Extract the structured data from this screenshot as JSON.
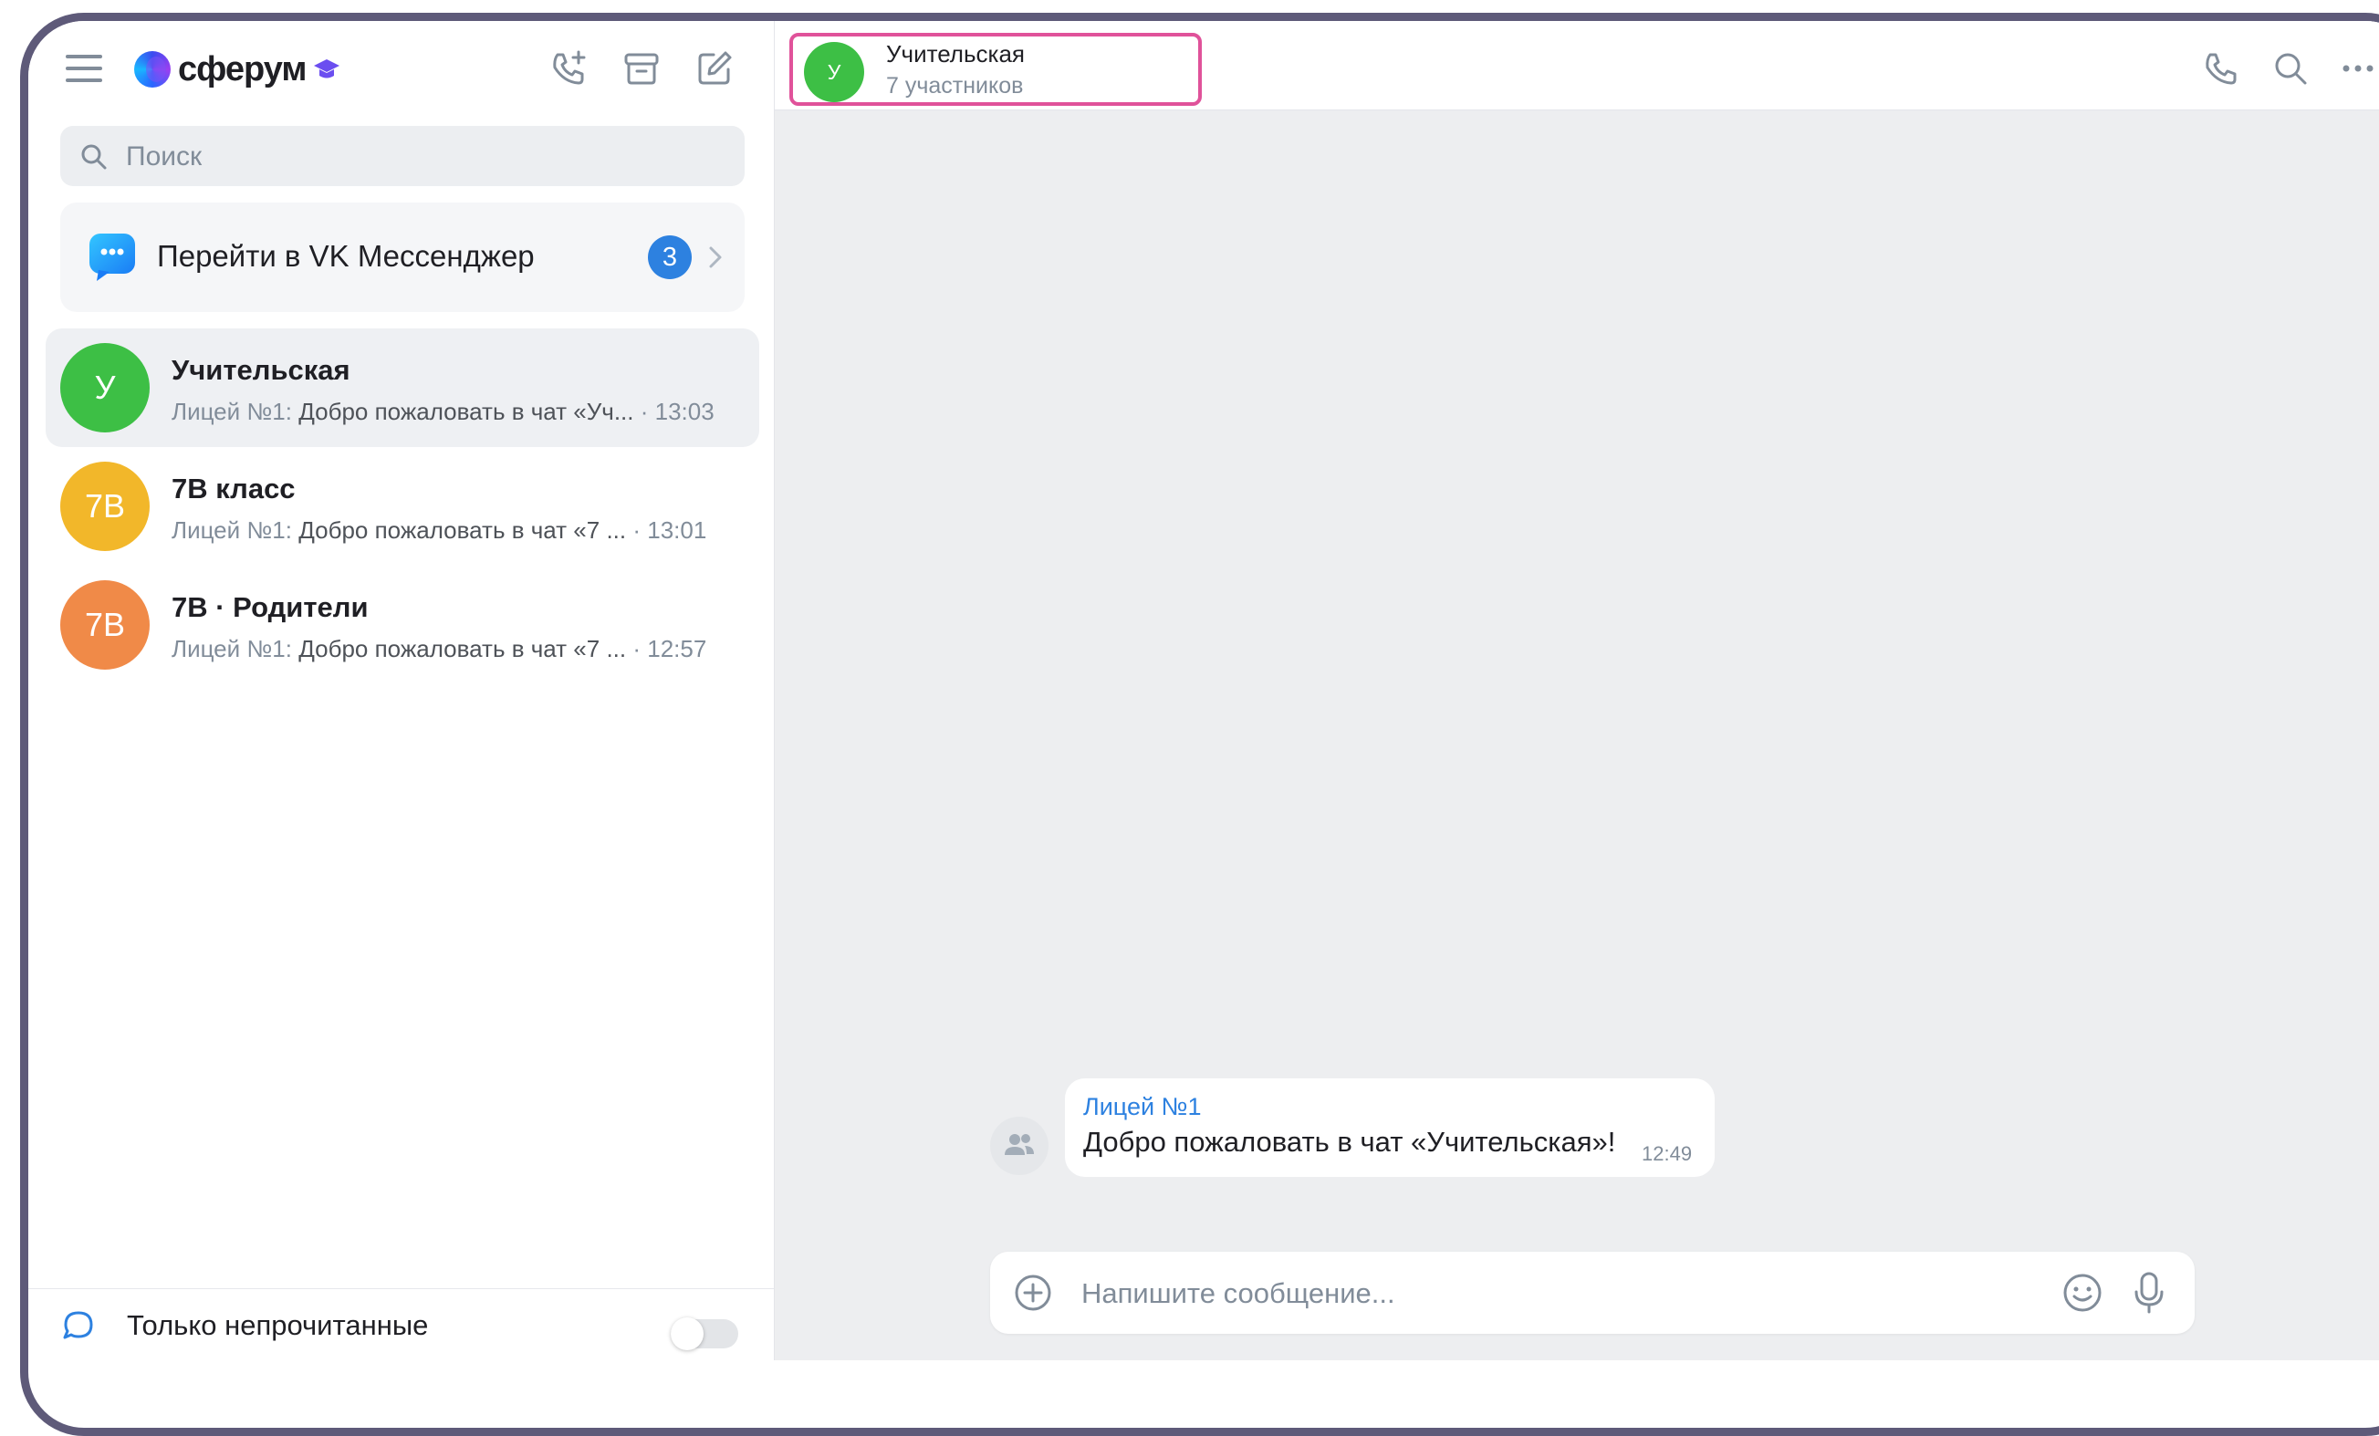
{
  "app": {
    "logo_text": "сферум"
  },
  "sidebar": {
    "search_placeholder": "Поиск",
    "vk_banner": {
      "label": "Перейти в VK Мессенджер",
      "badge": "3"
    },
    "chats": [
      {
        "title": "Учительская",
        "avatar_text": "У",
        "avatar_color": "#3dbf45",
        "author": "Лицей №1:",
        "preview": "Добро пожаловать в чат «Уч...",
        "time": "· 13:03",
        "active": true
      },
      {
        "title": "7В класс",
        "avatar_text": "7В",
        "avatar_color": "#f2b72a",
        "author": "Лицей №1:",
        "preview": "Добро пожаловать в чат «7 ...",
        "time": "· 13:01",
        "active": false
      },
      {
        "title": "7В · Родители",
        "avatar_text": "7В",
        "avatar_color": "#f08a48",
        "author": "Лицей №1:",
        "preview": "Добро пожаловать в чат «7 ...",
        "time": "· 12:57",
        "active": false
      }
    ],
    "filter_label": "Только непрочитанные",
    "filter_enabled": false
  },
  "header": {
    "avatar_text": "У",
    "title": "Учительская",
    "subtitle": "7 участников",
    "highlight_color": "#e0529a"
  },
  "messages": [
    {
      "author": "Лицей №1",
      "text": "Добро пожаловать в чат «Учительская»!",
      "time": "12:49"
    }
  ],
  "composer": {
    "placeholder": "Напишите сообщение..."
  },
  "colors": {
    "accent": "#2d81e0",
    "frame": "#5e5a79",
    "icon": "#818c99"
  }
}
